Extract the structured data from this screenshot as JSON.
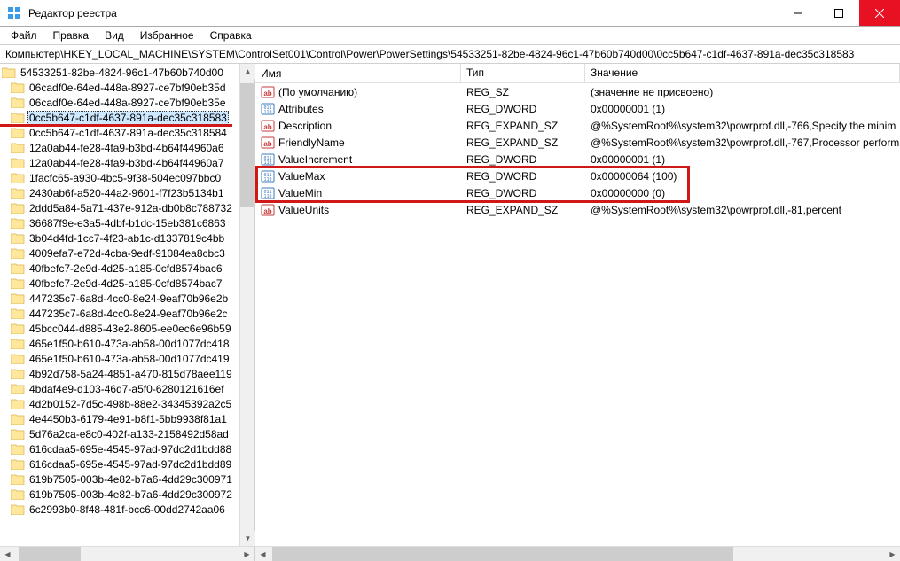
{
  "window": {
    "title": "Редактор реестра"
  },
  "menu": {
    "file": "Файл",
    "edit": "Правка",
    "view": "Вид",
    "favorites": "Избранное",
    "help": "Справка"
  },
  "address": "Компьютер\\HKEY_LOCAL_MACHINE\\SYSTEM\\ControlSet001\\Control\\Power\\PowerSettings\\54533251-82be-4824-96c1-47b60b740d00\\0cc5b647-c1df-4637-891a-dec35c318583",
  "tree_top": "54533251-82be-4824-96c1-47b60b740d00",
  "tree": [
    "06cadf0e-64ed-448a-8927-ce7bf90eb35d",
    "06cadf0e-64ed-448a-8927-ce7bf90eb35e",
    "0cc5b647-c1df-4637-891a-dec35c318583",
    "0cc5b647-c1df-4637-891a-dec35c318584",
    "12a0ab44-fe28-4fa9-b3bd-4b64f44960a6",
    "12a0ab44-fe28-4fa9-b3bd-4b64f44960a7",
    "1facfc65-a930-4bc5-9f38-504ec097bbc0",
    "2430ab6f-a520-44a2-9601-f7f23b5134b1",
    "2ddd5a84-5a71-437e-912a-db0b8c788732",
    "36687f9e-e3a5-4dbf-b1dc-15eb381c6863",
    "3b04d4fd-1cc7-4f23-ab1c-d1337819c4bb",
    "4009efa7-e72d-4cba-9edf-91084ea8cbc3",
    "40fbefc7-2e9d-4d25-a185-0cfd8574bac6",
    "40fbefc7-2e9d-4d25-a185-0cfd8574bac7",
    "447235c7-6a8d-4cc0-8e24-9eaf70b96e2b",
    "447235c7-6a8d-4cc0-8e24-9eaf70b96e2c",
    "45bcc044-d885-43e2-8605-ee0ec6e96b59",
    "465e1f50-b610-473a-ab58-00d1077dc418",
    "465e1f50-b610-473a-ab58-00d1077dc419",
    "4b92d758-5a24-4851-a470-815d78aee119",
    "4bdaf4e9-d103-46d7-a5f0-6280121616ef",
    "4d2b0152-7d5c-498b-88e2-34345392a2c5",
    "4e4450b3-6179-4e91-b8f1-5bb9938f81a1",
    "5d76a2ca-e8c0-402f-a133-2158492d58ad",
    "616cdaa5-695e-4545-97ad-97dc2d1bdd88",
    "616cdaa5-695e-4545-97ad-97dc2d1bdd89",
    "619b7505-003b-4e82-b7a6-4dd29c300971",
    "619b7505-003b-4e82-b7a6-4dd29c300972",
    "6c2993b0-8f48-481f-bcc6-00dd2742aa06"
  ],
  "tree_selected_index": 2,
  "columns": {
    "name": "Имя",
    "type": "Тип",
    "value": "Значение"
  },
  "values": [
    {
      "icon": "ab",
      "name": "(По умолчанию)",
      "type": "REG_SZ",
      "value": "(значение не присвоено)"
    },
    {
      "icon": "bin",
      "name": "Attributes",
      "type": "REG_DWORD",
      "value": "0x00000001 (1)"
    },
    {
      "icon": "ab",
      "name": "Description",
      "type": "REG_EXPAND_SZ",
      "value": "@%SystemRoot%\\system32\\powrprof.dll,-766,Specify the minim"
    },
    {
      "icon": "ab",
      "name": "FriendlyName",
      "type": "REG_EXPAND_SZ",
      "value": "@%SystemRoot%\\system32\\powrprof.dll,-767,Processor perform"
    },
    {
      "icon": "bin",
      "name": "ValueIncrement",
      "type": "REG_DWORD",
      "value": "0x00000001 (1)"
    },
    {
      "icon": "bin",
      "name": "ValueMax",
      "type": "REG_DWORD",
      "value": "0x00000064 (100)"
    },
    {
      "icon": "bin",
      "name": "ValueMin",
      "type": "REG_DWORD",
      "value": "0x00000000 (0)"
    },
    {
      "icon": "ab",
      "name": "ValueUnits",
      "type": "REG_EXPAND_SZ",
      "value": "@%SystemRoot%\\system32\\powrprof.dll,-81,percent"
    }
  ]
}
